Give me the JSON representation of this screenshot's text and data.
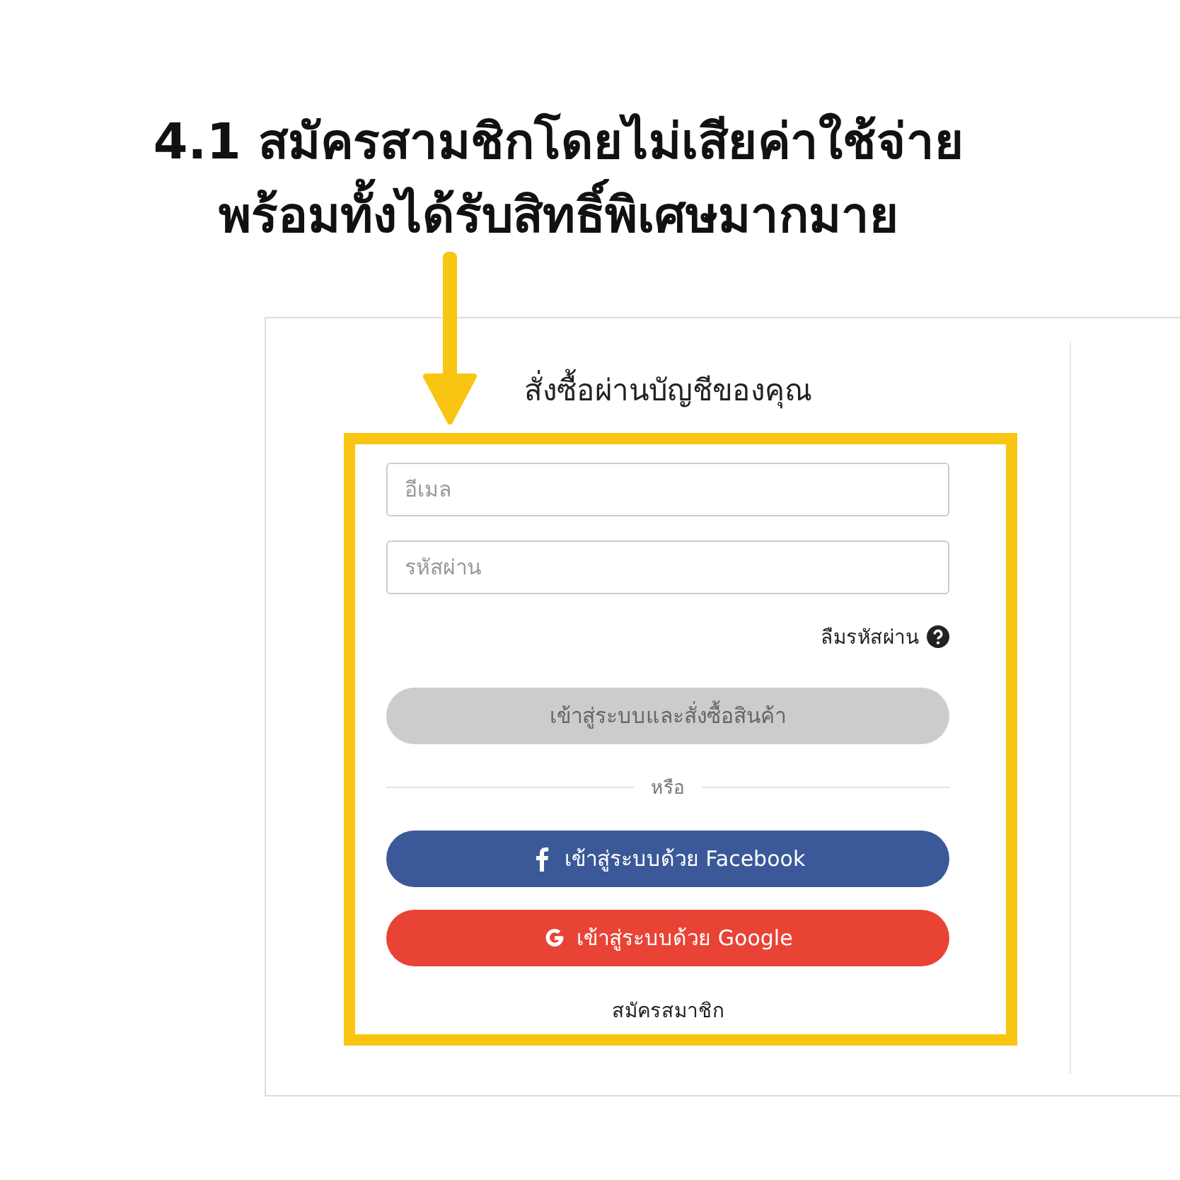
{
  "annotation": {
    "lines": [
      "4.1 สมัครสามชิกโดยไม่เสียค่าใช้จ่าย",
      "พร้อมทั้งได้รับสิทธิ์พิเศษมากมาย"
    ]
  },
  "form": {
    "title": "สั่งซื้อผ่านบัญชีของคุณ",
    "fields": [
      {
        "placeholder": "อีเมล"
      },
      {
        "placeholder": "รหัสผ่าน"
      }
    ],
    "forgot_password": "ลืมรหัสผ่าน",
    "login_button": {
      "label": "เข้าสู่ระบบและสั่งซื้อสินค้า",
      "disabled": true
    },
    "divider_text": "หรือ",
    "social_buttons": [
      {
        "kind": "facebook",
        "label": "เข้าสู่ระบบด้วย Facebook"
      },
      {
        "kind": "google",
        "label": "เข้าสู่ระบบด้วย Google"
      }
    ],
    "register_link": "สมัครสมาชิก"
  }
}
